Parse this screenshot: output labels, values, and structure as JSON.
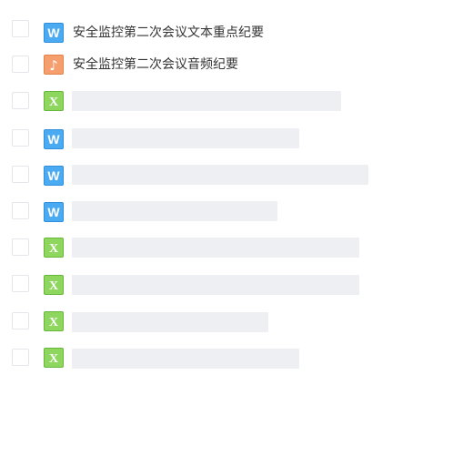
{
  "files": [
    {
      "type": "word",
      "icon": "word-doc-icon",
      "name": "安全监控第二次会议文本重点纪要"
    },
    {
      "type": "audio",
      "icon": "audio-file-icon",
      "name": "安全监控第二次会议音频纪要"
    },
    {
      "type": "excel",
      "icon": "excel-sheet-icon",
      "name": ""
    },
    {
      "type": "word",
      "icon": "word-doc-icon",
      "name": ""
    },
    {
      "type": "word",
      "icon": "word-doc-icon",
      "name": ""
    },
    {
      "type": "word",
      "icon": "word-doc-icon",
      "name": ""
    },
    {
      "type": "excel",
      "icon": "excel-sheet-icon",
      "name": ""
    },
    {
      "type": "excel",
      "icon": "excel-sheet-icon",
      "name": ""
    },
    {
      "type": "excel",
      "icon": "excel-sheet-icon",
      "name": ""
    },
    {
      "type": "excel",
      "icon": "excel-sheet-icon",
      "name": ""
    }
  ],
  "colors": {
    "word": "#4aaaf2",
    "audio": "#f59f6e",
    "excel": "#8fd65f",
    "placeholder": "#eeeff2"
  }
}
